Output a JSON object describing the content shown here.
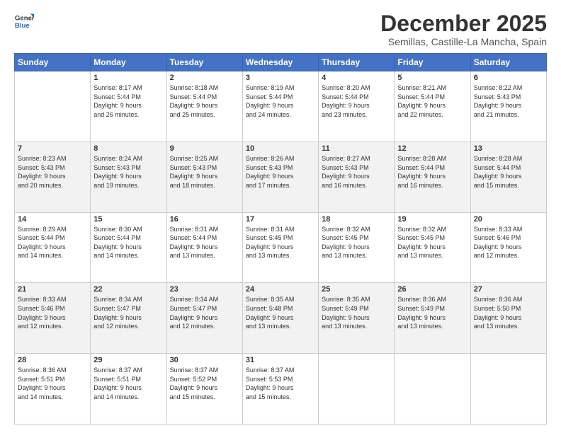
{
  "logo": {
    "line1": "General",
    "line2": "Blue"
  },
  "title": "December 2025",
  "location": "Semillas, Castille-La Mancha, Spain",
  "days_header": [
    "Sunday",
    "Monday",
    "Tuesday",
    "Wednesday",
    "Thursday",
    "Friday",
    "Saturday"
  ],
  "weeks": [
    [
      {
        "day": "",
        "info": ""
      },
      {
        "day": "1",
        "info": "Sunrise: 8:17 AM\nSunset: 5:44 PM\nDaylight: 9 hours\nand 26 minutes."
      },
      {
        "day": "2",
        "info": "Sunrise: 8:18 AM\nSunset: 5:44 PM\nDaylight: 9 hours\nand 25 minutes."
      },
      {
        "day": "3",
        "info": "Sunrise: 8:19 AM\nSunset: 5:44 PM\nDaylight: 9 hours\nand 24 minutes."
      },
      {
        "day": "4",
        "info": "Sunrise: 8:20 AM\nSunset: 5:44 PM\nDaylight: 9 hours\nand 23 minutes."
      },
      {
        "day": "5",
        "info": "Sunrise: 8:21 AM\nSunset: 5:44 PM\nDaylight: 9 hours\nand 22 minutes."
      },
      {
        "day": "6",
        "info": "Sunrise: 8:22 AM\nSunset: 5:43 PM\nDaylight: 9 hours\nand 21 minutes."
      }
    ],
    [
      {
        "day": "7",
        "info": "Sunrise: 8:23 AM\nSunset: 5:43 PM\nDaylight: 9 hours\nand 20 minutes."
      },
      {
        "day": "8",
        "info": "Sunrise: 8:24 AM\nSunset: 5:43 PM\nDaylight: 9 hours\nand 19 minutes."
      },
      {
        "day": "9",
        "info": "Sunrise: 8:25 AM\nSunset: 5:43 PM\nDaylight: 9 hours\nand 18 minutes."
      },
      {
        "day": "10",
        "info": "Sunrise: 8:26 AM\nSunset: 5:43 PM\nDaylight: 9 hours\nand 17 minutes."
      },
      {
        "day": "11",
        "info": "Sunrise: 8:27 AM\nSunset: 5:43 PM\nDaylight: 9 hours\nand 16 minutes."
      },
      {
        "day": "12",
        "info": "Sunrise: 8:28 AM\nSunset: 5:44 PM\nDaylight: 9 hours\nand 16 minutes."
      },
      {
        "day": "13",
        "info": "Sunrise: 8:28 AM\nSunset: 5:44 PM\nDaylight: 9 hours\nand 15 minutes."
      }
    ],
    [
      {
        "day": "14",
        "info": "Sunrise: 8:29 AM\nSunset: 5:44 PM\nDaylight: 9 hours\nand 14 minutes."
      },
      {
        "day": "15",
        "info": "Sunrise: 8:30 AM\nSunset: 5:44 PM\nDaylight: 9 hours\nand 14 minutes."
      },
      {
        "day": "16",
        "info": "Sunrise: 8:31 AM\nSunset: 5:44 PM\nDaylight: 9 hours\nand 13 minutes."
      },
      {
        "day": "17",
        "info": "Sunrise: 8:31 AM\nSunset: 5:45 PM\nDaylight: 9 hours\nand 13 minutes."
      },
      {
        "day": "18",
        "info": "Sunrise: 8:32 AM\nSunset: 5:45 PM\nDaylight: 9 hours\nand 13 minutes."
      },
      {
        "day": "19",
        "info": "Sunrise: 8:32 AM\nSunset: 5:45 PM\nDaylight: 9 hours\nand 13 minutes."
      },
      {
        "day": "20",
        "info": "Sunrise: 8:33 AM\nSunset: 5:46 PM\nDaylight: 9 hours\nand 12 minutes."
      }
    ],
    [
      {
        "day": "21",
        "info": "Sunrise: 8:33 AM\nSunset: 5:46 PM\nDaylight: 9 hours\nand 12 minutes."
      },
      {
        "day": "22",
        "info": "Sunrise: 8:34 AM\nSunset: 5:47 PM\nDaylight: 9 hours\nand 12 minutes."
      },
      {
        "day": "23",
        "info": "Sunrise: 8:34 AM\nSunset: 5:47 PM\nDaylight: 9 hours\nand 12 minutes."
      },
      {
        "day": "24",
        "info": "Sunrise: 8:35 AM\nSunset: 5:48 PM\nDaylight: 9 hours\nand 13 minutes."
      },
      {
        "day": "25",
        "info": "Sunrise: 8:35 AM\nSunset: 5:49 PM\nDaylight: 9 hours\nand 13 minutes."
      },
      {
        "day": "26",
        "info": "Sunrise: 8:36 AM\nSunset: 5:49 PM\nDaylight: 9 hours\nand 13 minutes."
      },
      {
        "day": "27",
        "info": "Sunrise: 8:36 AM\nSunset: 5:50 PM\nDaylight: 9 hours\nand 13 minutes."
      }
    ],
    [
      {
        "day": "28",
        "info": "Sunrise: 8:36 AM\nSunset: 5:51 PM\nDaylight: 9 hours\nand 14 minutes."
      },
      {
        "day": "29",
        "info": "Sunrise: 8:37 AM\nSunset: 5:51 PM\nDaylight: 9 hours\nand 14 minutes."
      },
      {
        "day": "30",
        "info": "Sunrise: 8:37 AM\nSunset: 5:52 PM\nDaylight: 9 hours\nand 15 minutes."
      },
      {
        "day": "31",
        "info": "Sunrise: 8:37 AM\nSunset: 5:53 PM\nDaylight: 9 hours\nand 15 minutes."
      },
      {
        "day": "",
        "info": ""
      },
      {
        "day": "",
        "info": ""
      },
      {
        "day": "",
        "info": ""
      }
    ]
  ]
}
